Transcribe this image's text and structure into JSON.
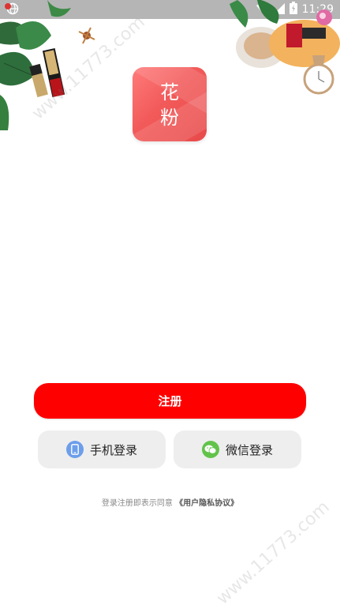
{
  "status_bar": {
    "time": "11:29"
  },
  "logo": {
    "line1": "花",
    "line2": "粉"
  },
  "actions": {
    "register_label": "注册",
    "phone_login_label": "手机登录",
    "wechat_login_label": "微信登录"
  },
  "agreement": {
    "prefix": "登录注册即表示同意",
    "link": "《用户隐私协议》"
  },
  "watermark": {
    "text": "www.11773.com"
  },
  "colors": {
    "accent": "#ff0000",
    "phone_icon": "#6d9eeb",
    "wechat_icon": "#62c34a"
  }
}
